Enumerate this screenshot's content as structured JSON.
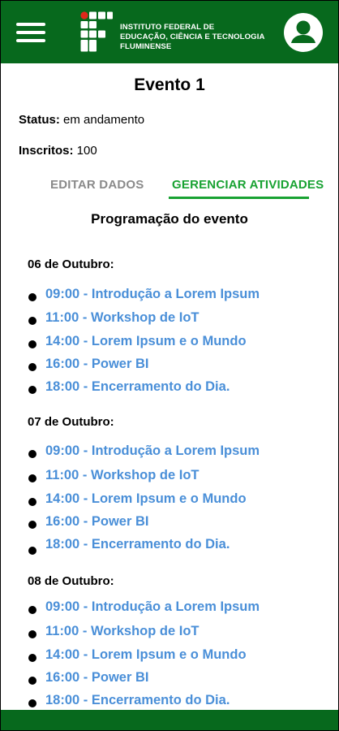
{
  "header": {
    "brand_line1": "INSTITUTO FEDERAL DE",
    "brand_line2": "EDUCAÇÃO, CIÊNCIA E TECNOLOGIA",
    "brand_line3": "FLUMINENSE",
    "menu_icon": "hamburger-icon",
    "profile_icon": "user-avatar-icon",
    "accent_color": "#07691d"
  },
  "event": {
    "title": "Evento 1",
    "status_label": "Status:",
    "status_value": " em andamento",
    "enrolled_label": "Inscritos:",
    "enrolled_value": " 100"
  },
  "tabs": {
    "edit": "EDITAR DADOS",
    "manage": "GERENCIAR ATIVIDADES",
    "active_color": "#18a232",
    "inactive_color": "#8a8a8a"
  },
  "schedule": {
    "title": "Programação do evento",
    "link_color": "#4a8fd8",
    "days": [
      {
        "label": "06 de Outubro:",
        "activities": [
          "09:00 - Introdução a Lorem Ipsum",
          "11:00 - Workshop de IoT",
          "14:00 - Lorem Ipsum e o Mundo",
          "16:00 - Power BI",
          "18:00 - Encerramento do Dia."
        ]
      },
      {
        "label": "07 de Outubro:",
        "activities": [
          "09:00 - Introdução a Lorem Ipsum",
          "11:00 - Workshop de IoT",
          "14:00 - Lorem Ipsum e o Mundo",
          "16:00 - Power BI",
          "18:00 - Encerramento do Dia."
        ]
      },
      {
        "label": "08 de Outubro:",
        "activities": [
          "09:00 - Introdução a Lorem Ipsum",
          "11:00 - Workshop de IoT",
          "14:00 - Lorem Ipsum e o Mundo",
          "16:00 - Power BI",
          "18:00 - Encerramento do Dia."
        ]
      }
    ]
  }
}
